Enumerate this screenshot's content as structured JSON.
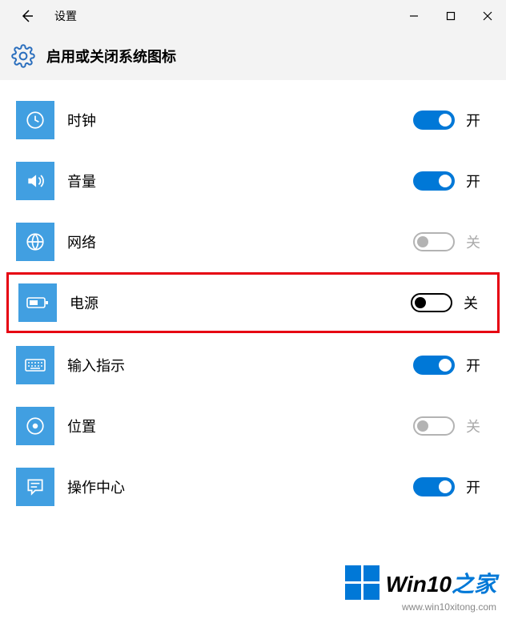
{
  "titlebar": {
    "title": "设置"
  },
  "header": {
    "title": "启用或关闭系统图标"
  },
  "items": [
    {
      "label": "时钟",
      "state": "on",
      "state_text": "开",
      "icon": "clock"
    },
    {
      "label": "音量",
      "state": "on",
      "state_text": "开",
      "icon": "volume"
    },
    {
      "label": "网络",
      "state": "off-disabled",
      "state_text": "关",
      "icon": "globe"
    },
    {
      "label": "电源",
      "state": "off-enabled",
      "state_text": "关",
      "icon": "battery",
      "highlight": true
    },
    {
      "label": "输入指示",
      "state": "on",
      "state_text": "开",
      "icon": "keyboard"
    },
    {
      "label": "位置",
      "state": "off-disabled",
      "state_text": "关",
      "icon": "location"
    },
    {
      "label": "操作中心",
      "state": "on",
      "state_text": "开",
      "icon": "action-center"
    }
  ],
  "watermark": {
    "brand_prefix": "Win10",
    "brand_suffix": "之家",
    "url": "www.win10xitong.com"
  }
}
